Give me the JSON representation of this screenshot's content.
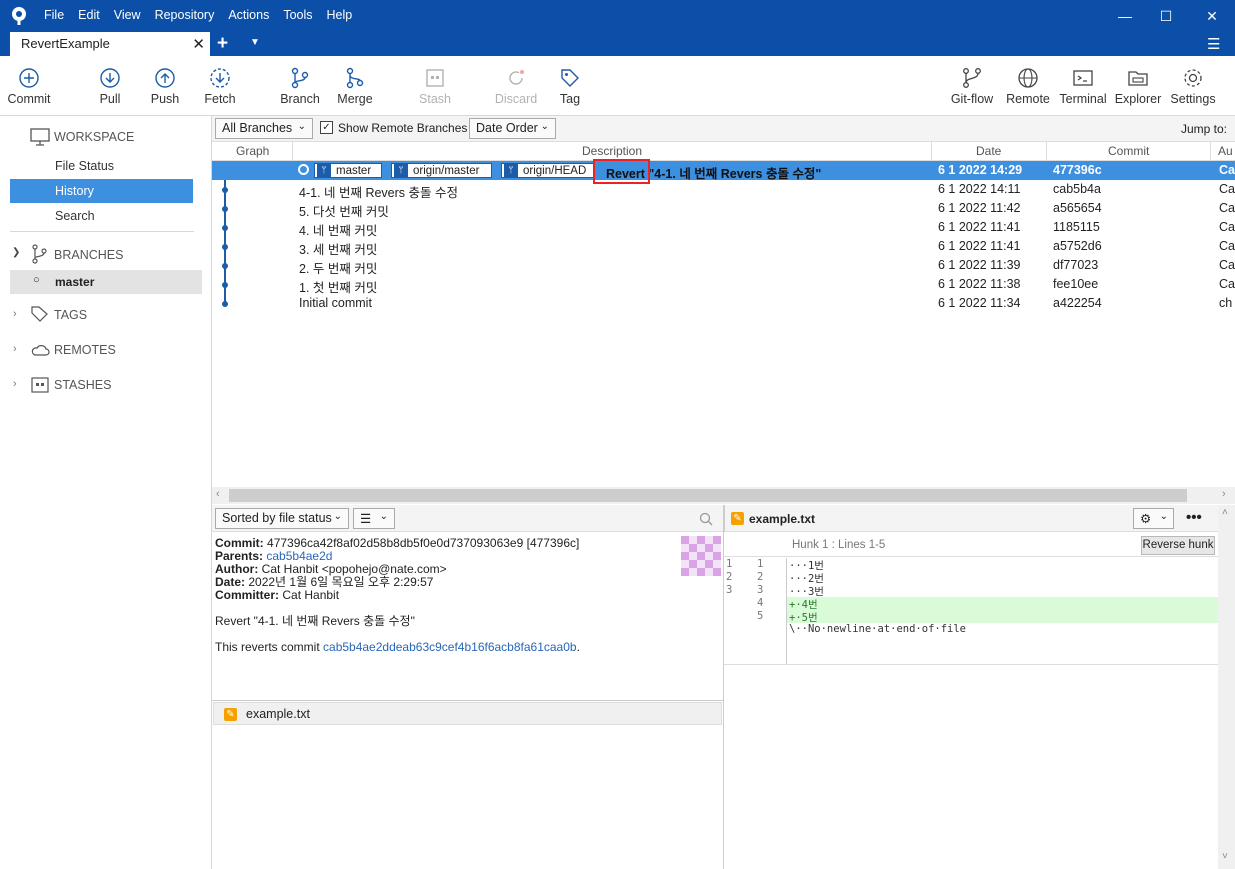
{
  "menu": [
    "File",
    "Edit",
    "View",
    "Repository",
    "Actions",
    "Tools",
    "Help"
  ],
  "tab": {
    "title": "RevertExample"
  },
  "toolbar": {
    "commit": "Commit",
    "pull": "Pull",
    "push": "Push",
    "fetch": "Fetch",
    "branch": "Branch",
    "merge": "Merge",
    "stash": "Stash",
    "discard": "Discard",
    "tag": "Tag",
    "gitflow": "Git-flow",
    "remote": "Remote",
    "terminal": "Terminal",
    "explorer": "Explorer",
    "settings": "Settings"
  },
  "sidebar": {
    "workspace": "WORKSPACE",
    "file_status": "File Status",
    "history": "History",
    "search": "Search",
    "branches": "BRANCHES",
    "master": "master",
    "tags": "TAGS",
    "remotes": "REMOTES",
    "stashes": "STASHES"
  },
  "filters": {
    "all_branches": "All Branches",
    "show_remote": "Show Remote Branches",
    "date_order": "Date Order",
    "jump_to": "Jump to:"
  },
  "columns": {
    "graph": "Graph",
    "description": "Description",
    "date": "Date",
    "commit": "Commit",
    "author": "Au"
  },
  "refs": {
    "master": "master",
    "origin_master": "origin/master",
    "origin_head": "origin/HEAD"
  },
  "commits": [
    {
      "desc": "Revert \"4-1. 네 번째 Revers 충돌 수정\"",
      "date": "6 1 2022 14:29",
      "hash": "477396c",
      "author": "Ca"
    },
    {
      "desc": "4-1. 네 번째 Revers 충돌 수정",
      "date": "6 1 2022 14:11",
      "hash": "cab5b4a",
      "author": "Ca"
    },
    {
      "desc": "5. 다섯 번째 커밋",
      "date": "6 1 2022 11:42",
      "hash": "a565654",
      "author": "Ca"
    },
    {
      "desc": "4. 네 번째 커밋",
      "date": "6 1 2022 11:41",
      "hash": "1185115",
      "author": "Ca"
    },
    {
      "desc": "3. 세 번째 커밋",
      "date": "6 1 2022 11:41",
      "hash": "a5752d6",
      "author": "Ca"
    },
    {
      "desc": "2. 두 번째 커밋",
      "date": "6 1 2022 11:39",
      "hash": "df77023",
      "author": "Ca"
    },
    {
      "desc": "1. 첫 번째 커밋",
      "date": "6 1 2022 11:38",
      "hash": "fee10ee",
      "author": "Ca"
    },
    {
      "desc": "Initial commit",
      "date": "6 1 2022 11:34",
      "hash": "a422254",
      "author": "ch"
    }
  ],
  "bottom": {
    "sort": "Sorted by file status",
    "commit_label": "Commit:",
    "commit_value": "477396ca42f8af02d58b8db5f0e0d737093063e9 [477396c]",
    "parents_label": "Parents:",
    "parents_value": "cab5b4ae2d",
    "author_label": "Author:",
    "author_value": "Cat Hanbit <popohejo@nate.com>",
    "date_label": "Date:",
    "date_value": "2022년 1월 6일 목요일 오후 2:29:57",
    "committer_label": "Committer:",
    "committer_value": "Cat Hanbit",
    "message": "Revert \"4-1. 네 번째 Revers 충돌 수정\"",
    "reverts_prefix": "This reverts commit ",
    "reverts_hash": "cab5b4ae2ddeab63c9cef4b16f6acb8fa61caa0b",
    "reverts_suffix": ".",
    "file": "example.txt"
  },
  "diff": {
    "file": "example.txt",
    "hunk": "Hunk 1 : Lines 1-5",
    "reverse_hunk": "Reverse hunk",
    "lines": [
      {
        "old": "1",
        "new": "1",
        "text": "···1번",
        "type": "ctx"
      },
      {
        "old": "2",
        "new": "2",
        "text": "···2번",
        "type": "ctx"
      },
      {
        "old": "3",
        "new": "3",
        "text": "···3번",
        "type": "ctx"
      },
      {
        "old": "",
        "new": "4",
        "text": "+·4번",
        "type": "add"
      },
      {
        "old": "",
        "new": "5",
        "text": "+·5번",
        "type": "add"
      },
      {
        "old": "",
        "new": "",
        "text": "\\··No·newline·at·end·of·file",
        "type": "ctx"
      }
    ]
  },
  "colors": {
    "titlebar": "#0b4fa8",
    "selection": "#3d8fe0",
    "added": "#dafbd8",
    "highlight_box": "#e22222"
  }
}
